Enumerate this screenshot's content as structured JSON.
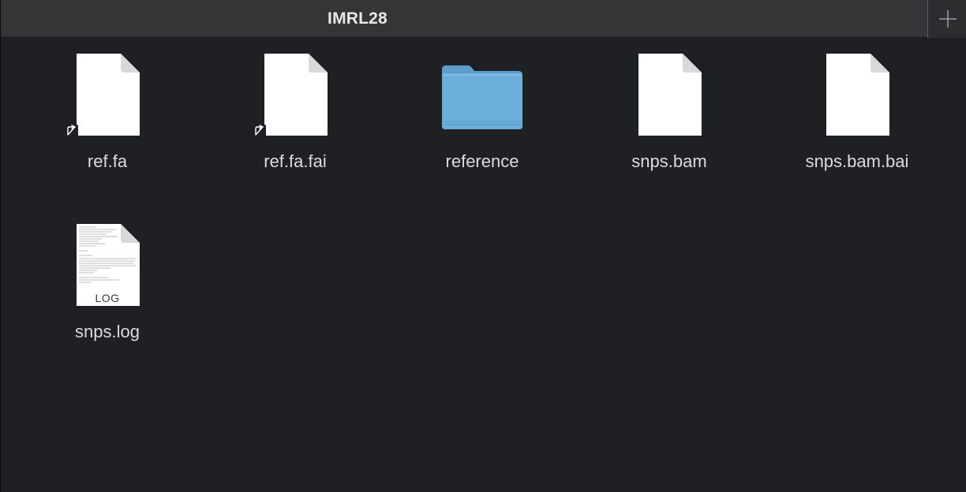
{
  "window": {
    "tab_title": "IMRL28",
    "new_tab_icon": "plus-icon"
  },
  "files": [
    {
      "name": "ref.fa",
      "kind": "document",
      "alias": true,
      "icon": "file-alias-icon"
    },
    {
      "name": "ref.fa.fai",
      "kind": "document",
      "alias": true,
      "icon": "file-alias-icon"
    },
    {
      "name": "reference",
      "kind": "folder",
      "alias": false,
      "icon": "folder-icon"
    },
    {
      "name": "snps.bam",
      "kind": "document",
      "alias": false,
      "icon": "file-icon"
    },
    {
      "name": "snps.bam.bai",
      "kind": "document",
      "alias": false,
      "icon": "file-icon"
    },
    {
      "name": "snps.log",
      "kind": "log",
      "alias": false,
      "icon": "log-file-icon",
      "badge": "LOG"
    }
  ],
  "colors": {
    "background": "#1f2023",
    "tabbar": "#353538",
    "folder": "#6aaed9",
    "label": "#dcdcde"
  }
}
